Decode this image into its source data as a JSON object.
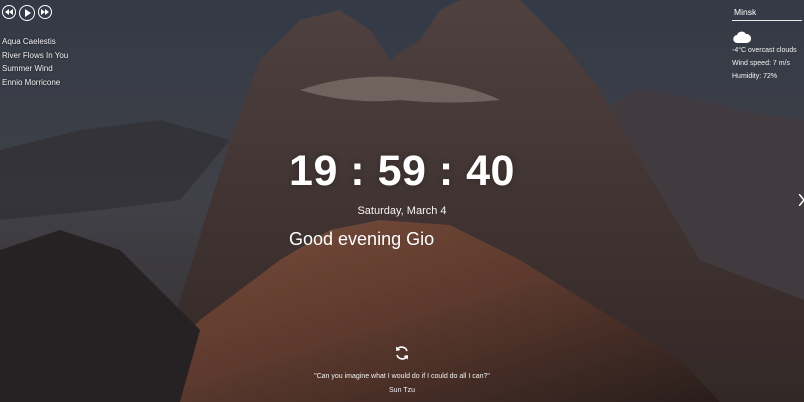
{
  "player": {
    "playlist": [
      "Aqua Caelestis",
      "River Flows In You",
      "Summer Wind",
      "Ennio Morricone"
    ]
  },
  "weather": {
    "city": "Minsk",
    "icon": "cloud-icon",
    "temperature_description": "-4°C   overcast clouds",
    "wind": "Wind speed: 7 m/s",
    "humidity": "Humidity: 72%"
  },
  "clock": {
    "time": "19 : 59 : 40",
    "date": "Saturday, March 4"
  },
  "greeting": {
    "text": "Good evening",
    "name": "Gio"
  },
  "quote": {
    "text": "\"Can you imagine what I would do if I could do all I can?\"",
    "author": "Sun Tzu"
  },
  "icons": [
    "play-prev-icon",
    "play-icon",
    "play-next-icon",
    "cloud-icon",
    "refresh-icon",
    "slide-next-icon"
  ]
}
